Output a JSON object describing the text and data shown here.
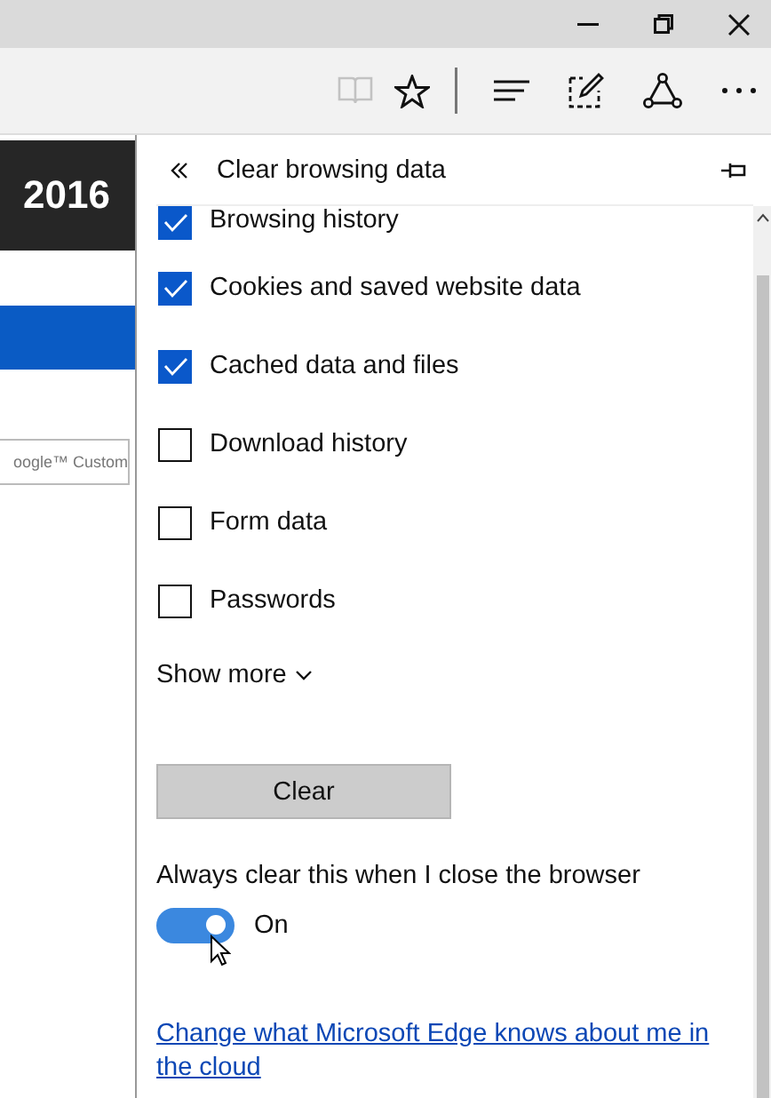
{
  "toolbar": [
    {
      "kind": "reading",
      "disabled": true
    },
    {
      "kind": "favorite",
      "disabled": false
    },
    {
      "kind": "separator"
    },
    {
      "kind": "hub",
      "disabled": false
    },
    {
      "kind": "note",
      "disabled": false
    },
    {
      "kind": "share",
      "disabled": false
    },
    {
      "kind": "more",
      "disabled": false
    }
  ],
  "page": {
    "heading": "2016",
    "search_placeholder": "oogle™ Custom"
  },
  "panel": {
    "title": "Clear browsing data",
    "options": [
      {
        "label": "Browsing history",
        "checked": true
      },
      {
        "label": "Cookies and saved website data",
        "checked": true
      },
      {
        "label": "Cached data and files",
        "checked": true
      },
      {
        "label": "Download history",
        "checked": false
      },
      {
        "label": "Form data",
        "checked": false
      },
      {
        "label": "Passwords",
        "checked": false
      }
    ],
    "show_more": "Show more",
    "clear_button": "Clear",
    "always_clear": {
      "label": "Always clear this when I close the browser",
      "on": true,
      "state_text": "On"
    },
    "link": "Change what Microsoft Edge knows about me in the cloud"
  }
}
